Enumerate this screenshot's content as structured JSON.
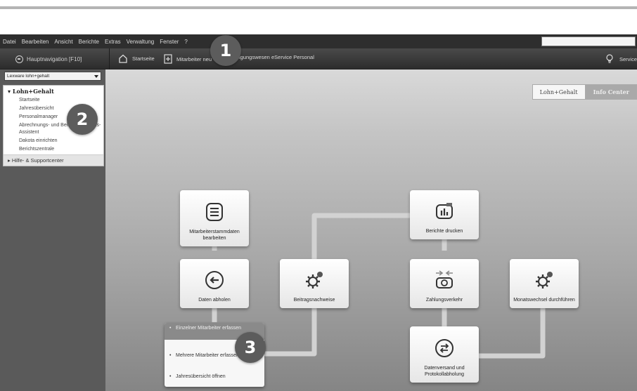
{
  "menu": [
    "Datei",
    "Bearbeiten",
    "Ansicht",
    "Berichte",
    "Extras",
    "Verwaltung",
    "Fenster",
    "?"
  ],
  "toolbar": {
    "nav_toggle": "Hauptnavigation [F10]",
    "startseite": "Startseite",
    "mitarbeiter": "Mitarbeiter neu",
    "meldewesen": "igungswesen",
    "eservice": "eService Personal",
    "service": "Service"
  },
  "sidebar": {
    "product_select": "Lexware lohn+gehalt",
    "section_title": "Lohn+Gehalt",
    "links": [
      "Startseite",
      "Jahresübersicht",
      "Personalmanager",
      "Abrechnungs- und Beitragsnachweis-Assistent",
      "Dakota einrichten",
      "Berichtszentrale"
    ],
    "help": "Hilfe- & Supportcenter"
  },
  "tabs": [
    "Lohn+Gehalt",
    "Info Center"
  ],
  "cards": {
    "stammdaten": "Mitarbeiterstammdaten bearbeiten",
    "daten_abholen": "Daten abholen",
    "beitragsnachweise": "Beitragsnachweise",
    "berichte": "Berichte drucken",
    "zahlungsverkehr": "Zahlungsverkehr",
    "monatswechsel": "Monatswechsel durchführen",
    "datenversand": "Datenversand und Protokollabholung"
  },
  "dropdown": [
    "Einzelner Mitarbeiter erfassen",
    "Mehrere Mitarbeiter erfassen",
    "Jahresübersicht öffnen"
  ],
  "badges": [
    "1",
    "2",
    "3"
  ],
  "colors": {
    "menubar": "#2e2e2e",
    "sidebar": "#5a5a5a",
    "badge": "#5c5c5c",
    "connector": "#d2d2d2"
  }
}
